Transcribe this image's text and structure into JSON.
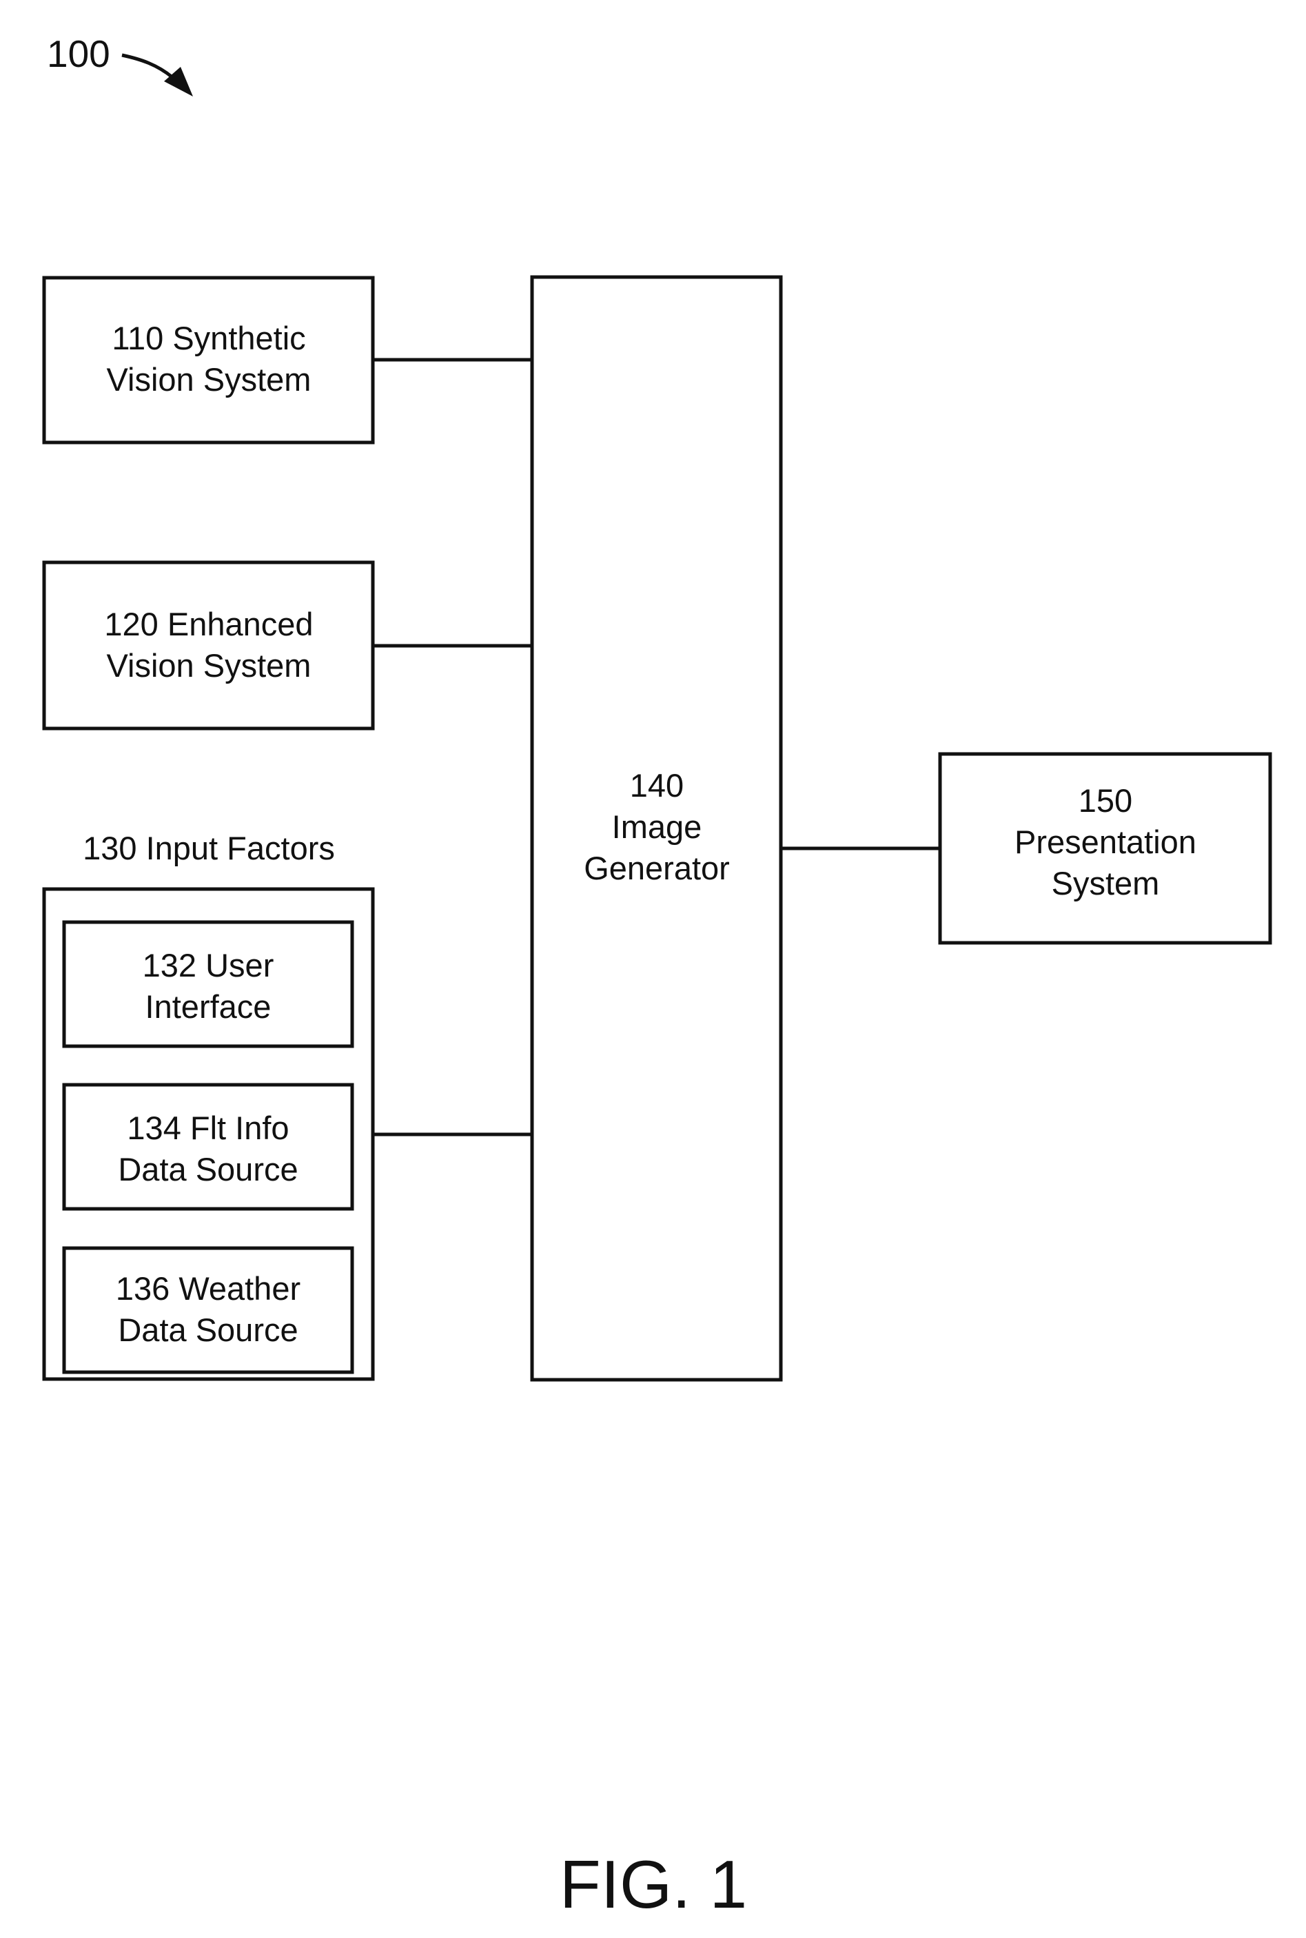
{
  "figure": {
    "reference": "100",
    "caption": "FIG. 1"
  },
  "blocks": {
    "b110": {
      "lines": [
        "110 Synthetic",
        "Vision System"
      ]
    },
    "b120": {
      "lines": [
        "120 Enhanced",
        "Vision System"
      ]
    },
    "b130": {
      "label": "130 Input Factors"
    },
    "b132": {
      "lines": [
        "132 User",
        "Interface"
      ]
    },
    "b134": {
      "lines": [
        "134 Flt Info",
        "Data Source"
      ]
    },
    "b136": {
      "lines": [
        "136 Weather",
        "Data Source"
      ]
    },
    "b140": {
      "lines": [
        "140",
        "Image",
        "Generator"
      ]
    },
    "b150": {
      "lines": [
        "150",
        "Presentation",
        "System"
      ]
    }
  },
  "connections": [
    {
      "from": "110 Synthetic Vision System",
      "to": "140 Image Generator"
    },
    {
      "from": "120 Enhanced Vision System",
      "to": "140 Image Generator"
    },
    {
      "from": "130 Input Factors",
      "to": "140 Image Generator"
    },
    {
      "from": "140 Image Generator",
      "to": "150 Presentation System"
    }
  ],
  "colors": {
    "ink": "#111111",
    "paper": "#ffffff"
  }
}
